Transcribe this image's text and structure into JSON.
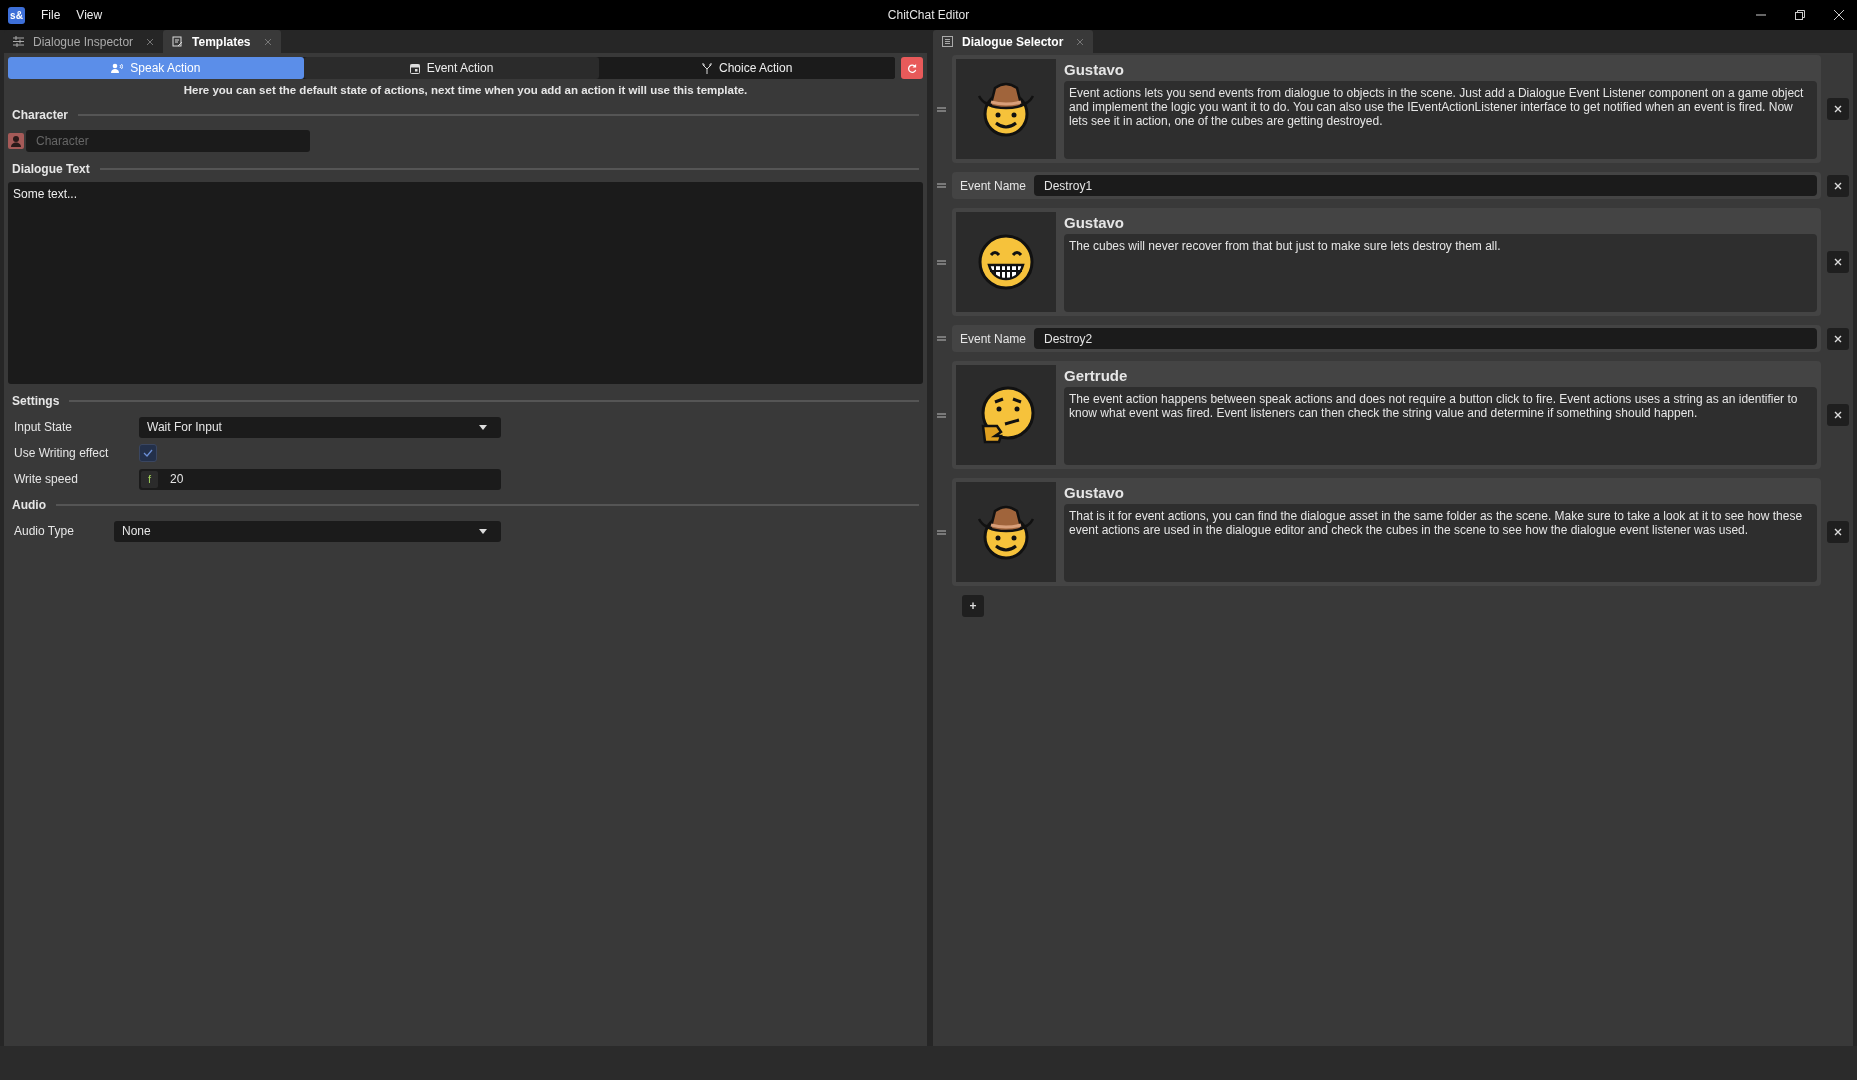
{
  "window": {
    "logo": "s&",
    "title": "ChitChat Editor",
    "menu": [
      "File",
      "View"
    ]
  },
  "left_tabs": [
    {
      "label": "Dialogue Inspector",
      "selected": false
    },
    {
      "label": "Templates",
      "selected": true
    }
  ],
  "action_tabs": [
    {
      "label": "Speak Action",
      "selected": true
    },
    {
      "label": "Event Action",
      "selected": false
    },
    {
      "label": "Choice Action",
      "selected": false
    }
  ],
  "hint": "Here you can set the default state of actions, next time when you add an action it will use this template.",
  "character": {
    "heading": "Character",
    "placeholder": "Character"
  },
  "dialogue_text": {
    "heading": "Dialogue Text",
    "value": "Some text..."
  },
  "settings": {
    "heading": "Settings",
    "input_state_label": "Input State",
    "input_state": "Wait For Input",
    "writing_effect_label": "Use Writing effect",
    "writing_effect_checked": true,
    "write_speed_label": "Write speed",
    "write_speed_type": "f",
    "write_speed": "20"
  },
  "audio": {
    "heading": "Audio",
    "type_label": "Audio Type",
    "type": "None"
  },
  "right_tab": {
    "label": "Dialogue Selector",
    "selected": true
  },
  "actions": [
    {
      "kind": "speak",
      "avatar": {
        "kind": "cowboy"
      },
      "name": "Gustavo",
      "text": "Event actions lets you send events from dialogue to objects in the scene. Just add a Dialogue Event Listener component on a game object and implement the logic you want it to do. You can also use the IEventActionListener interface to get notified when an event is fired. Now lets see it in action, one of the cubes are getting destroyed."
    },
    {
      "kind": "event",
      "label": "Event Name",
      "value": "Destroy1"
    },
    {
      "kind": "speak",
      "avatar": {
        "kind": "grin"
      },
      "name": "Gustavo",
      "text": "The cubes will never recover from that but just to make sure lets destroy them all."
    },
    {
      "kind": "event",
      "label": "Event Name",
      "value": "Destroy2"
    },
    {
      "kind": "speak",
      "avatar": {
        "kind": "thinking"
      },
      "name": "Gertrude",
      "text": "The event action happens between speak actions and does not require a button click to fire. Event actions uses a string as an identifier to know what event was fired. Event listeners can then check the string value and determine if something should happen."
    },
    {
      "kind": "speak",
      "avatar": {
        "kind": "cowboy"
      },
      "name": "Gustavo",
      "text": "That is it for event actions, you can find the dialogue asset in the same folder as the scene. Make sure to take a look at it to see how these event actions are used in the dialogue editor and check the cubes in the scene to see how the dialogue event listener was used."
    }
  ],
  "add_button": "+"
}
